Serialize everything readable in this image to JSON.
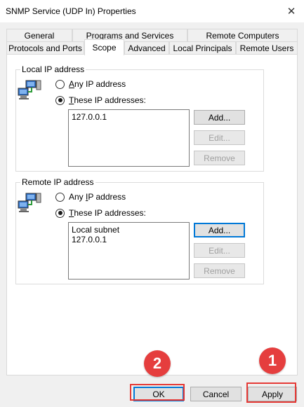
{
  "window": {
    "title": "SNMP Service (UDP In) Properties",
    "close_glyph": "✕"
  },
  "tabs": {
    "row_back": [
      "General",
      "Programs and Services",
      "Remote Computers"
    ],
    "row_front": [
      "Protocols and Ports",
      "Scope",
      "Advanced",
      "Local Principals",
      "Remote Users"
    ],
    "active": "Scope"
  },
  "local_ip": {
    "group_label": "Local IP address",
    "any_first": "A",
    "any_rest": "ny IP address",
    "these_first": "T",
    "these_rest": "hese IP addresses:",
    "selected": "these",
    "addresses": [
      "127.0.0.1"
    ],
    "add_label": "Add...",
    "edit_label": "Edit...",
    "remove_label": "Remove"
  },
  "remote_ip": {
    "group_label": "Remote IP address",
    "any_pre": "Any ",
    "any_ul": "I",
    "any_post": "P address",
    "these_first": "T",
    "these_rest": "hese IP addresses:",
    "selected": "these",
    "addresses": [
      "Local subnet",
      "127.0.0.1"
    ],
    "add_label": "Add...",
    "edit_label": "Edit...",
    "remove_label": "Remove"
  },
  "footer": {
    "ok_label": "OK",
    "cancel_label": "Cancel",
    "apply_label": "Apply"
  },
  "annotations": {
    "badge_1": "1",
    "badge_2": "2",
    "badge_color": "#e53e3e",
    "highlight_color": "#e53935"
  },
  "icon": "network-computers-icon"
}
